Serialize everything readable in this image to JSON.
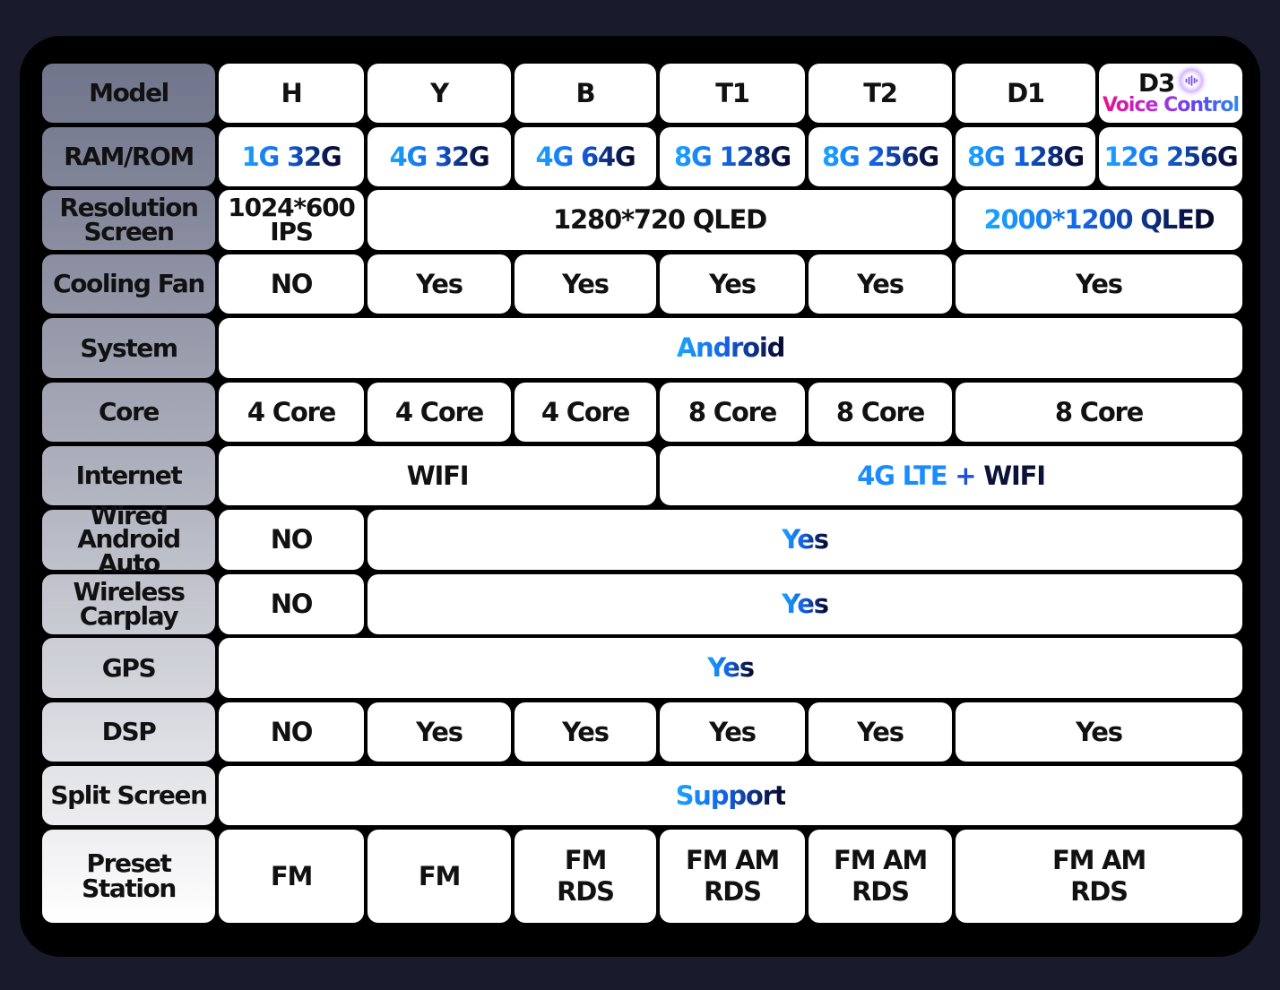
{
  "table": {
    "columns": [
      "H",
      "Y",
      "B",
      "T1",
      "T2",
      "D1",
      "D3"
    ],
    "d3_badge": {
      "label": "D3",
      "subtitle": "Voice Control",
      "icon": "voice-wave-icon"
    },
    "row_labels": {
      "model": "Model",
      "ram_rom": "RAM/ROM",
      "resolution_screen": [
        "Resolution",
        "Screen"
      ],
      "cooling_fan": "Cooling Fan",
      "system": "System",
      "core": "Core",
      "internet": "Internet",
      "wired_android_auto": [
        "Wired Android",
        "Auto"
      ],
      "wireless_carplay": [
        "Wireless",
        "Carplay"
      ],
      "gps": "GPS",
      "dsp": "DSP",
      "split_screen": "Split Screen",
      "preset_station": "Preset Station"
    },
    "ram_rom": [
      "1G 32G",
      "4G 32G",
      "4G 64G",
      "8G 128G",
      "8G 256G",
      "8G 128G",
      "12G 256G"
    ],
    "resolution": {
      "h": [
        "1024*600",
        "IPS"
      ],
      "y_t2": "1280*720 QLED",
      "d1_d3": "2000*1200 QLED"
    },
    "cooling_fan": {
      "h": "NO",
      "y": "Yes",
      "b": "Yes",
      "t1": "Yes",
      "t2": "Yes",
      "d1_d3": "Yes"
    },
    "system": "Android",
    "core": {
      "h": "4 Core",
      "y": "4 Core",
      "b": "4 Core",
      "t1": "8 Core",
      "t2": "8 Core",
      "d1_d3": "8 Core"
    },
    "internet": {
      "h_b": "WIFI",
      "t1_d3": {
        "part1": "4G LTE",
        "plus": "+",
        "part2": "WIFI"
      }
    },
    "wired_android_auto": {
      "h": "NO",
      "y_d3": "Yes"
    },
    "wireless_carplay": {
      "h": "NO",
      "y_d3": "Yes"
    },
    "gps": "Yes",
    "dsp": {
      "h": "NO",
      "y": "Yes",
      "b": "Yes",
      "t1": "Yes",
      "t2": "Yes",
      "d1_d3": "Yes"
    },
    "split_screen": "Support",
    "preset_station": {
      "h": [
        "FM"
      ],
      "y": [
        "FM"
      ],
      "b": [
        "FM",
        "RDS"
      ],
      "t1": [
        "FM AM",
        "RDS"
      ],
      "t2": [
        "FM AM",
        "RDS"
      ],
      "d1_d3": [
        "FM AM",
        "RDS"
      ]
    }
  },
  "colors": {
    "background": "#191a2c",
    "frame": "#000000",
    "label_top": "#7a7e92",
    "label_bottom": "#ffffff",
    "accent_blue": "#1a8cff",
    "accent_navy": "#0a1850",
    "voice_pink": "#e8108f",
    "voice_purple": "#5a48ec"
  }
}
